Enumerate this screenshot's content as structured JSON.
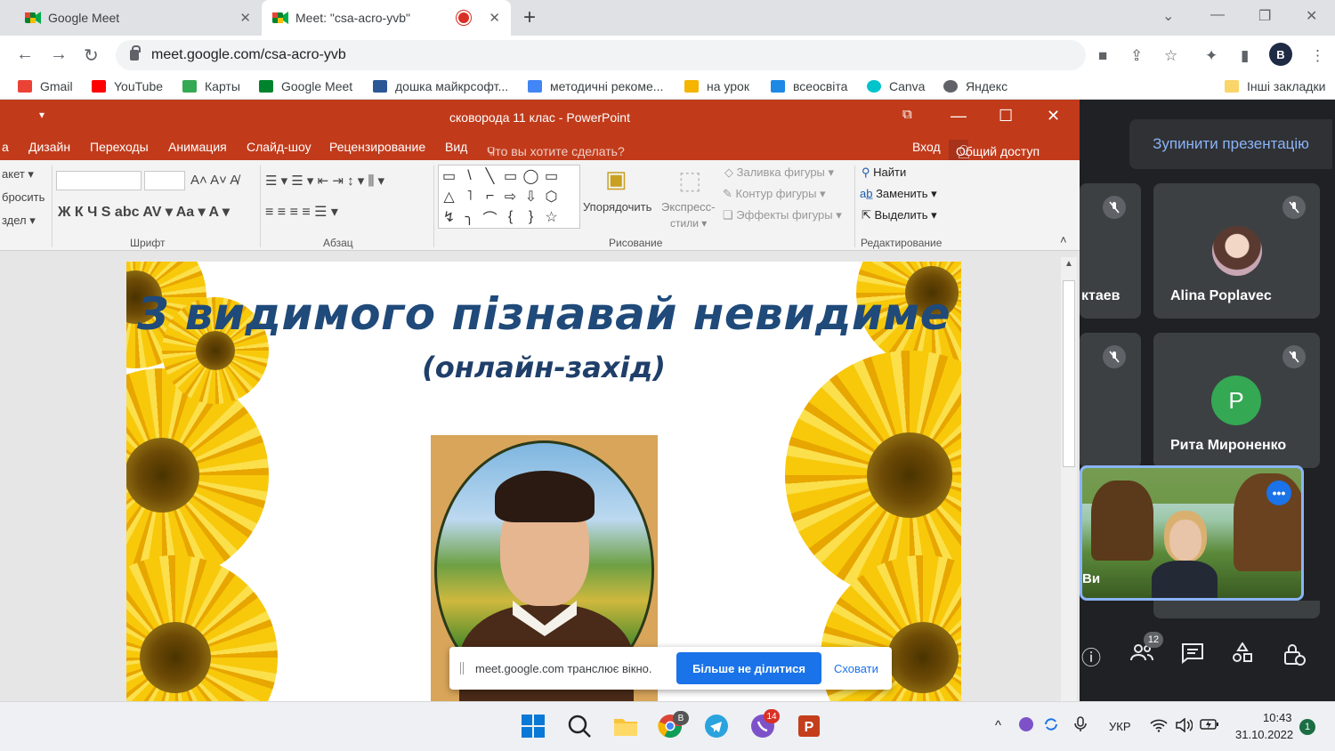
{
  "browser": {
    "tabs": [
      {
        "title": "Google Meet",
        "close": "✕"
      },
      {
        "title": "Meet: \"csa-acro-yvb\"",
        "close": "✕"
      }
    ],
    "new_tab": "+",
    "window_controls": {
      "tab_search": "⌄",
      "minimize": "—",
      "restore": "❐",
      "close": "✕"
    },
    "nav": {
      "back": "←",
      "forward": "→",
      "reload": "↻"
    },
    "url": "meet.google.com/csa-acro-yvb",
    "toolbar_icons": {
      "camera": "■",
      "share": "⇪",
      "star": "☆",
      "extensions": "✦",
      "sidebar": "▮",
      "menu": "⋮"
    },
    "profile_initial": "B",
    "bookmarks": [
      {
        "label": "Gmail",
        "color": "#ea4335"
      },
      {
        "label": "YouTube",
        "color": "#ff0000"
      },
      {
        "label": "Карты",
        "color": "#34a853"
      },
      {
        "label": "Google Meet",
        "color": "#00832d"
      },
      {
        "label": "дошка майкрсофт...",
        "color": "#2b5797"
      },
      {
        "label": "методичні рекоме...",
        "color": "#4285f4"
      },
      {
        "label": "на урок",
        "color": "#f4b400"
      },
      {
        "label": "всеосвіта",
        "color": "#1e88e5"
      },
      {
        "label": "Canva",
        "color": "#00c4cc"
      },
      {
        "label": "Яндекс",
        "color": "#5f6368"
      }
    ],
    "other_bookmarks": "Інші закладки"
  },
  "ppt": {
    "title": "сковорода 11 клас - PowerPoint",
    "qat": "▾",
    "window_buttons": {
      "ribbon": "⧉",
      "minimize": "—",
      "maximize": "☐",
      "close": "✕"
    },
    "menu": [
      {
        "label": "а"
      },
      {
        "label": "Дизайн"
      },
      {
        "label": "Переходы"
      },
      {
        "label": "Анимация"
      },
      {
        "label": "Слайд-шоу"
      },
      {
        "label": "Рецензирование"
      },
      {
        "label": "Вид"
      }
    ],
    "tell_me": "Что вы хотите сделать?",
    "login": "Вход",
    "share": "Общий доступ",
    "ribbon": {
      "slides_items": [
        "акет ▾",
        "бросить",
        "здел ▾"
      ],
      "font_group": "Шрифт",
      "font_format_row": "Ж  К  Ч  S  abc  AV ▾  Aa ▾   A ▾",
      "font_size_row": "A˄  A˅    A̸",
      "paragraph_group": "Абзац",
      "paragraph_top": "☰ ▾  ☰ ▾   ⇤  ⇥   ↕ ▾   ⫼ ▾",
      "paragraph_bottom": "≡   ≡   ≡   ≡    ☰ ▾",
      "shapes": [
        "▭",
        "\\",
        "╲",
        "▭",
        "◯",
        "▭",
        "△",
        "˥",
        "⌐",
        "⇨",
        "⇩",
        "⬡",
        "↯",
        "╮",
        "⌒",
        "{",
        "}",
        "☆"
      ],
      "arrange": "Упорядочить",
      "quick_styles_1": "Экспресс-",
      "quick_styles_2": "стили ▾",
      "shape_fill": "Заливка фигуры ▾",
      "shape_outline": "Контур фигуры ▾",
      "shape_effects": "Эффекты фигуры ▾",
      "drawing_group": "Рисование",
      "find": "Найти",
      "replace": "Заменить ▾",
      "select": "Выделить ▾",
      "editing_group": "Редактирование"
    },
    "slide": {
      "title": "З видимого пізнавай невидиме",
      "subtitle": "(онлайн-захід)"
    }
  },
  "sharing_bar": {
    "message": "meet.google.com транслює вікно.",
    "stop": "Більше не ділитися",
    "hide": "Сховати"
  },
  "meet": {
    "stop_presenting": "Зупинити презентацію",
    "participants": [
      {
        "name": "ктаев"
      },
      {
        "name": "Alina Poplavec"
      },
      {
        "name": "Рита Мироненко",
        "initial": "P",
        "color": "#34a853"
      },
      {
        "name": "Ви"
      }
    ],
    "mute_glyph": "🎙",
    "more_glyph": "•••",
    "controls": {
      "info": "ⓘ",
      "people": "👥",
      "chat": "💬",
      "activities": "⬡",
      "host": "🔒"
    },
    "participant_count": "12"
  },
  "taskbar": {
    "chrome_badge": "B",
    "viber_badge": "14",
    "tray_arrow": "^",
    "language": "УКР",
    "time": "10:43",
    "date": "31.10.2022",
    "notifications": "1"
  }
}
